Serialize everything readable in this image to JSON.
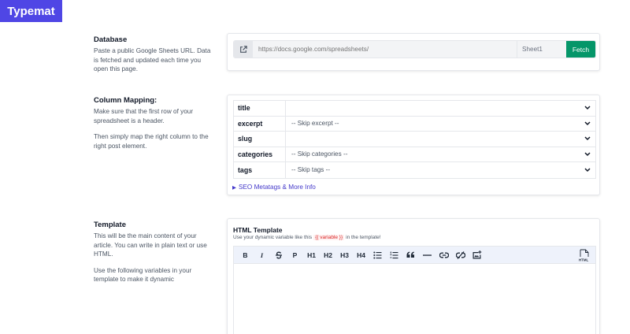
{
  "brand": {
    "name": "Typemat",
    "color": "#4f46e5"
  },
  "database": {
    "title": "Database",
    "desc": "Paste a public Google Sheets URL. Data is fetched and updated each time you open this page.",
    "url_placeholder": "https://docs.google.com/spreadsheets/",
    "sheet_value": "Sheet1",
    "fetch_label": "Fetch",
    "fetch_color": "#059669",
    "icon": "external-link-icon"
  },
  "mapping": {
    "title": "Column Mapping:",
    "desc1": "Make sure that the first row of your spreadsheet is a header.",
    "desc2": "Then simply map the right column to the right post element.",
    "rows": [
      {
        "key": "title",
        "value": ""
      },
      {
        "key": "excerpt",
        "value": "-- Skip excerpt --"
      },
      {
        "key": "slug",
        "value": ""
      },
      {
        "key": "categories",
        "value": "-- Skip categories --"
      },
      {
        "key": "tags",
        "value": "-- Skip tags --"
      }
    ],
    "seo_link": "SEO Metatags & More Info"
  },
  "template": {
    "title": "Template",
    "desc1": "This will be the main content of your article. You can write in plain text or use HTML.",
    "desc2": "Use the following variables in your template to make it dynamic",
    "editor_title": "HTML Template",
    "hint_before": "Use your dynamic variable like this",
    "hint_code": "{{ variable }}",
    "hint_after": "in the template!",
    "toolbar": {
      "bold": "B",
      "italic": "I",
      "paragraph": "P",
      "h1": "H1",
      "h2": "H2",
      "h3": "H3",
      "h4": "H4",
      "html_label": "HTML"
    }
  }
}
